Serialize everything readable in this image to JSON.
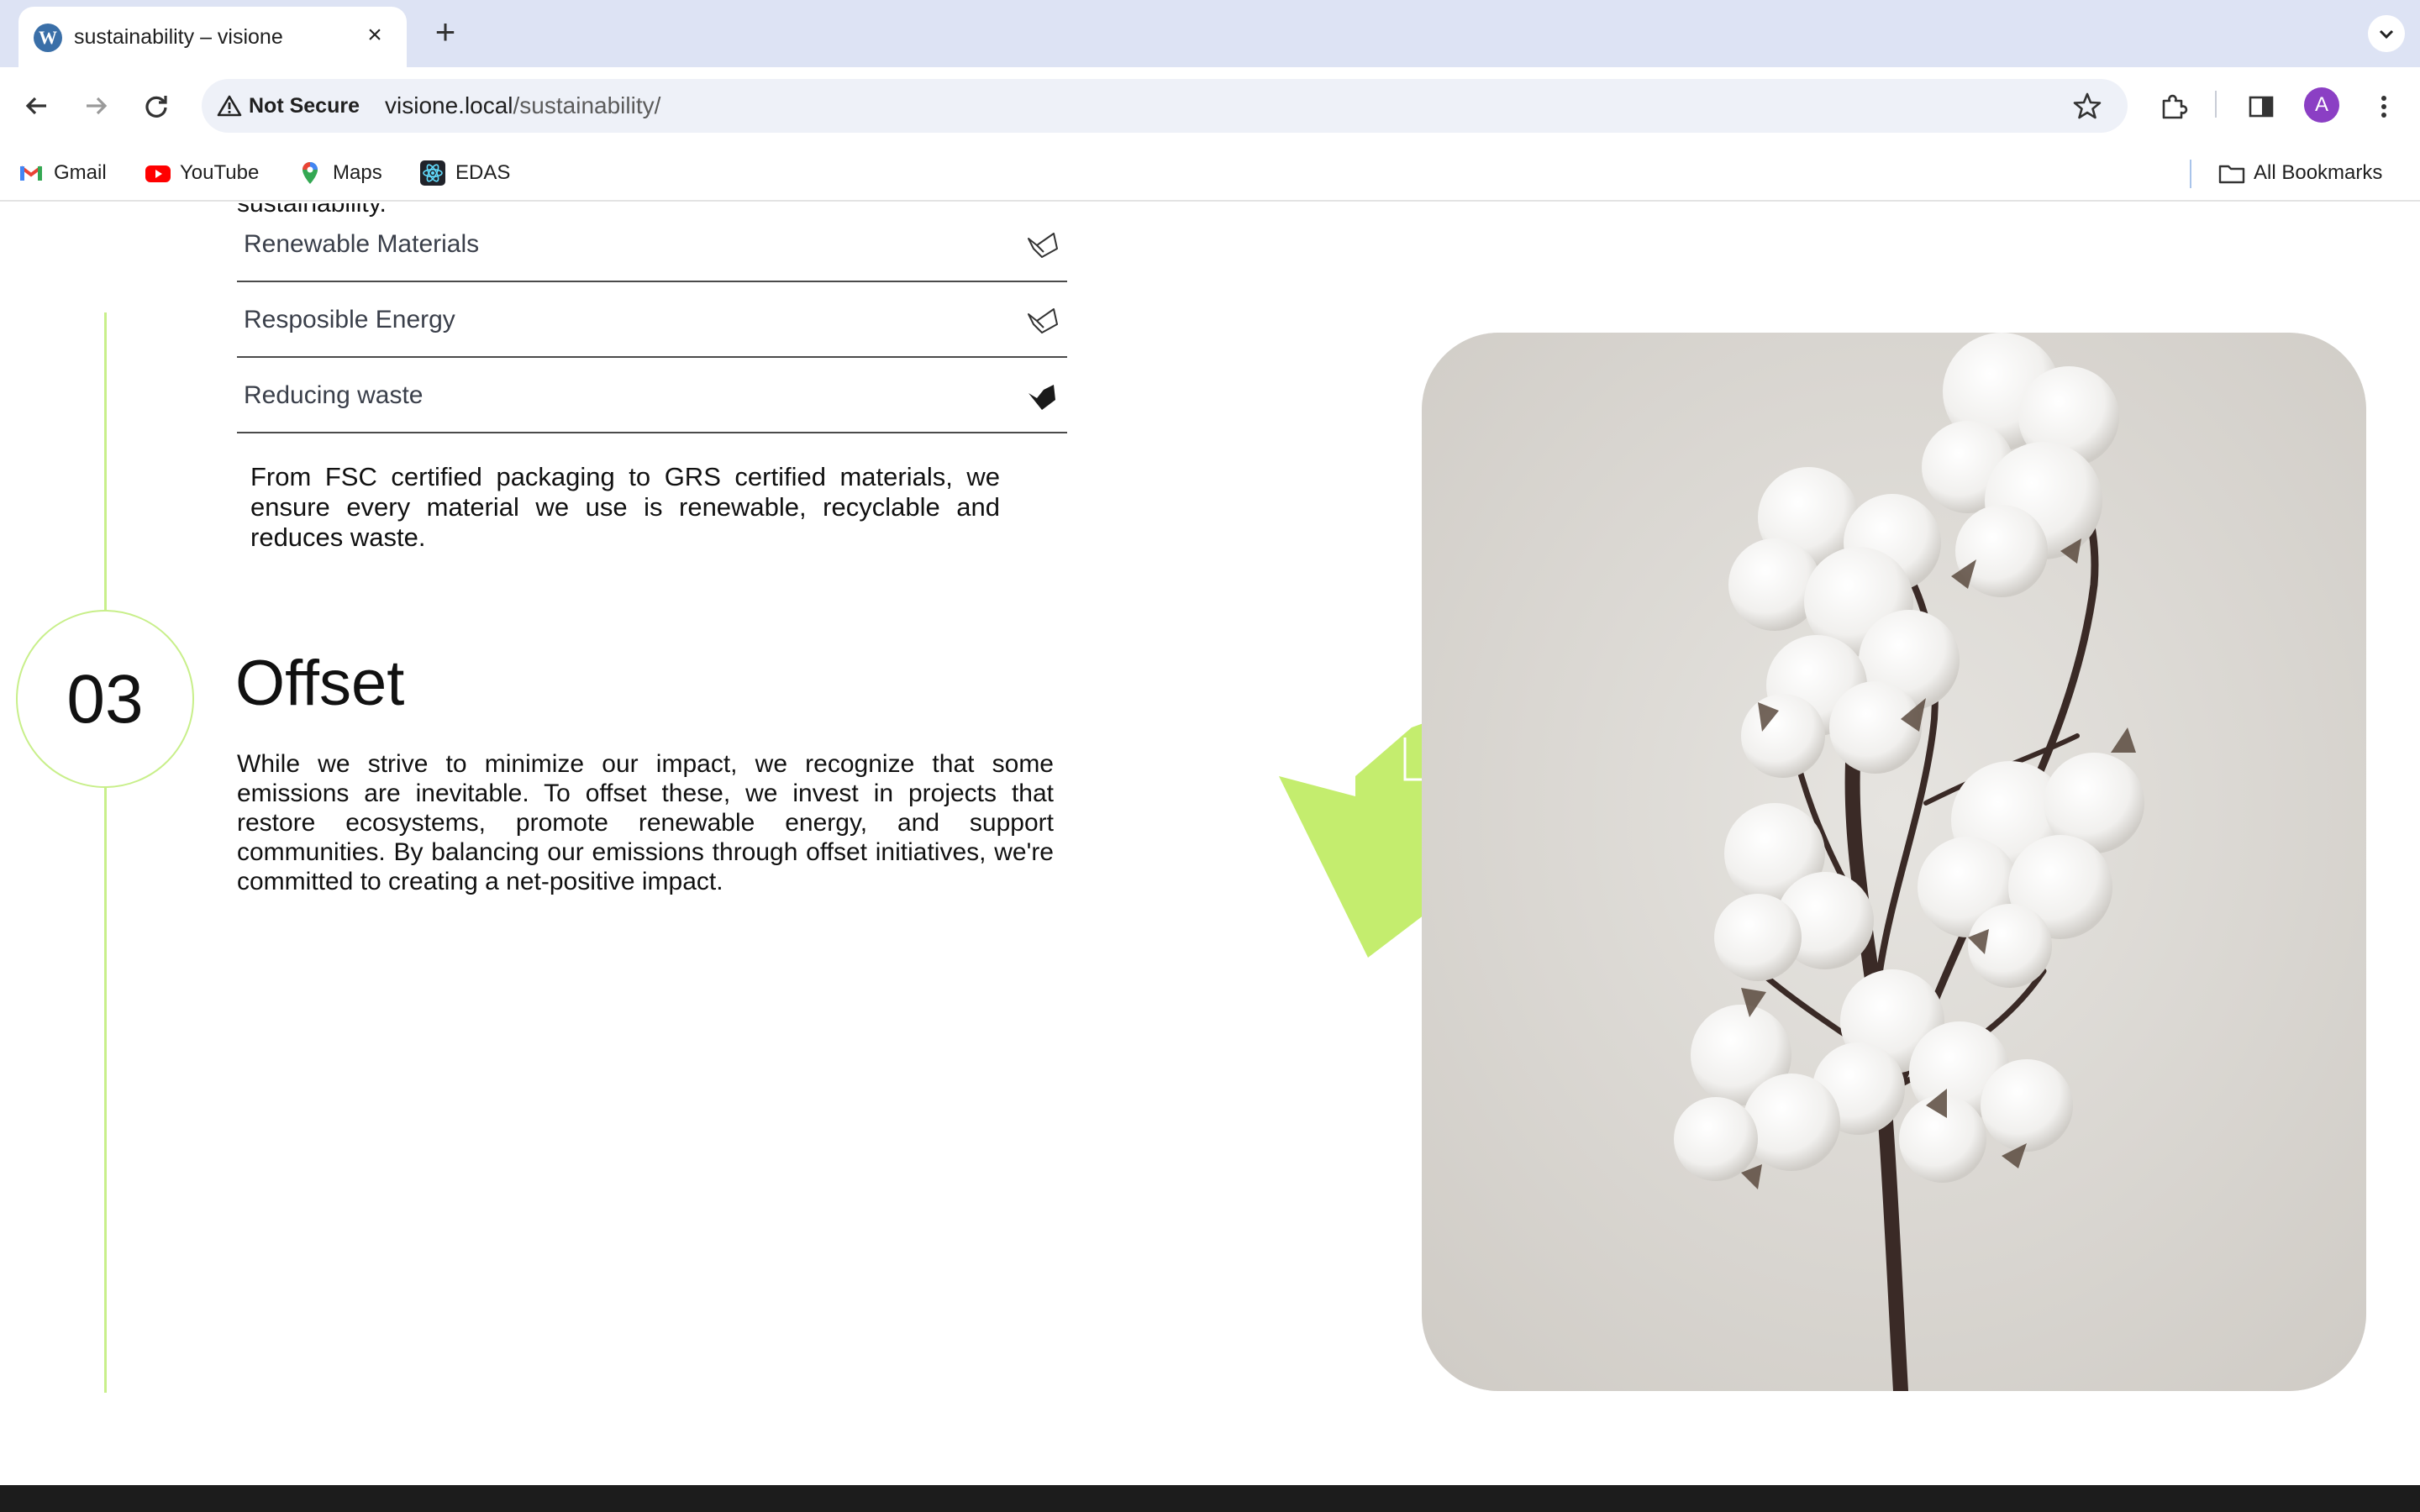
{
  "browser": {
    "tab": {
      "title": "sustainability – visione",
      "favicon": "wordpress-icon"
    },
    "address_bar": {
      "security_label": "Not Secure",
      "host": "visione.local",
      "path": "/sustainability/"
    },
    "profile_initial": "A",
    "bookmarks": [
      {
        "label": "Gmail",
        "icon": "gmail-icon"
      },
      {
        "label": "YouTube",
        "icon": "youtube-icon"
      },
      {
        "label": "Maps",
        "icon": "maps-icon"
      },
      {
        "label": "EDAS",
        "icon": "react-icon"
      }
    ],
    "all_bookmarks_label": "All Bookmarks"
  },
  "page": {
    "cut_off_text": "sustainability.",
    "accordion": [
      {
        "label": "Renewable Materials",
        "icon": "leaf-outline-icon",
        "expanded": false
      },
      {
        "label": "Resposible Energy",
        "icon": "leaf-outline-icon",
        "expanded": false
      },
      {
        "label": "Reducing waste",
        "icon": "leaf-filled-icon",
        "expanded": true,
        "body": "From FSC certified packaging to GRS certified materials, we ensure every material we use is renewable, recyclable and reduces waste."
      }
    ],
    "step": {
      "number": "03",
      "title": "Offset",
      "body": "While we strive to minimize our impact, we recognize that some emissions are inevitable. To offset these, we invest in projects that restore ecosystems, promote renewable energy, and support communities. By balancing our emissions through offset initiatives, we're committed to creating a net-positive impact."
    },
    "colors": {
      "accent_green": "#c4ed6e",
      "timeline_green": "#c8ef8a",
      "footer": "#1c1c1c"
    }
  }
}
